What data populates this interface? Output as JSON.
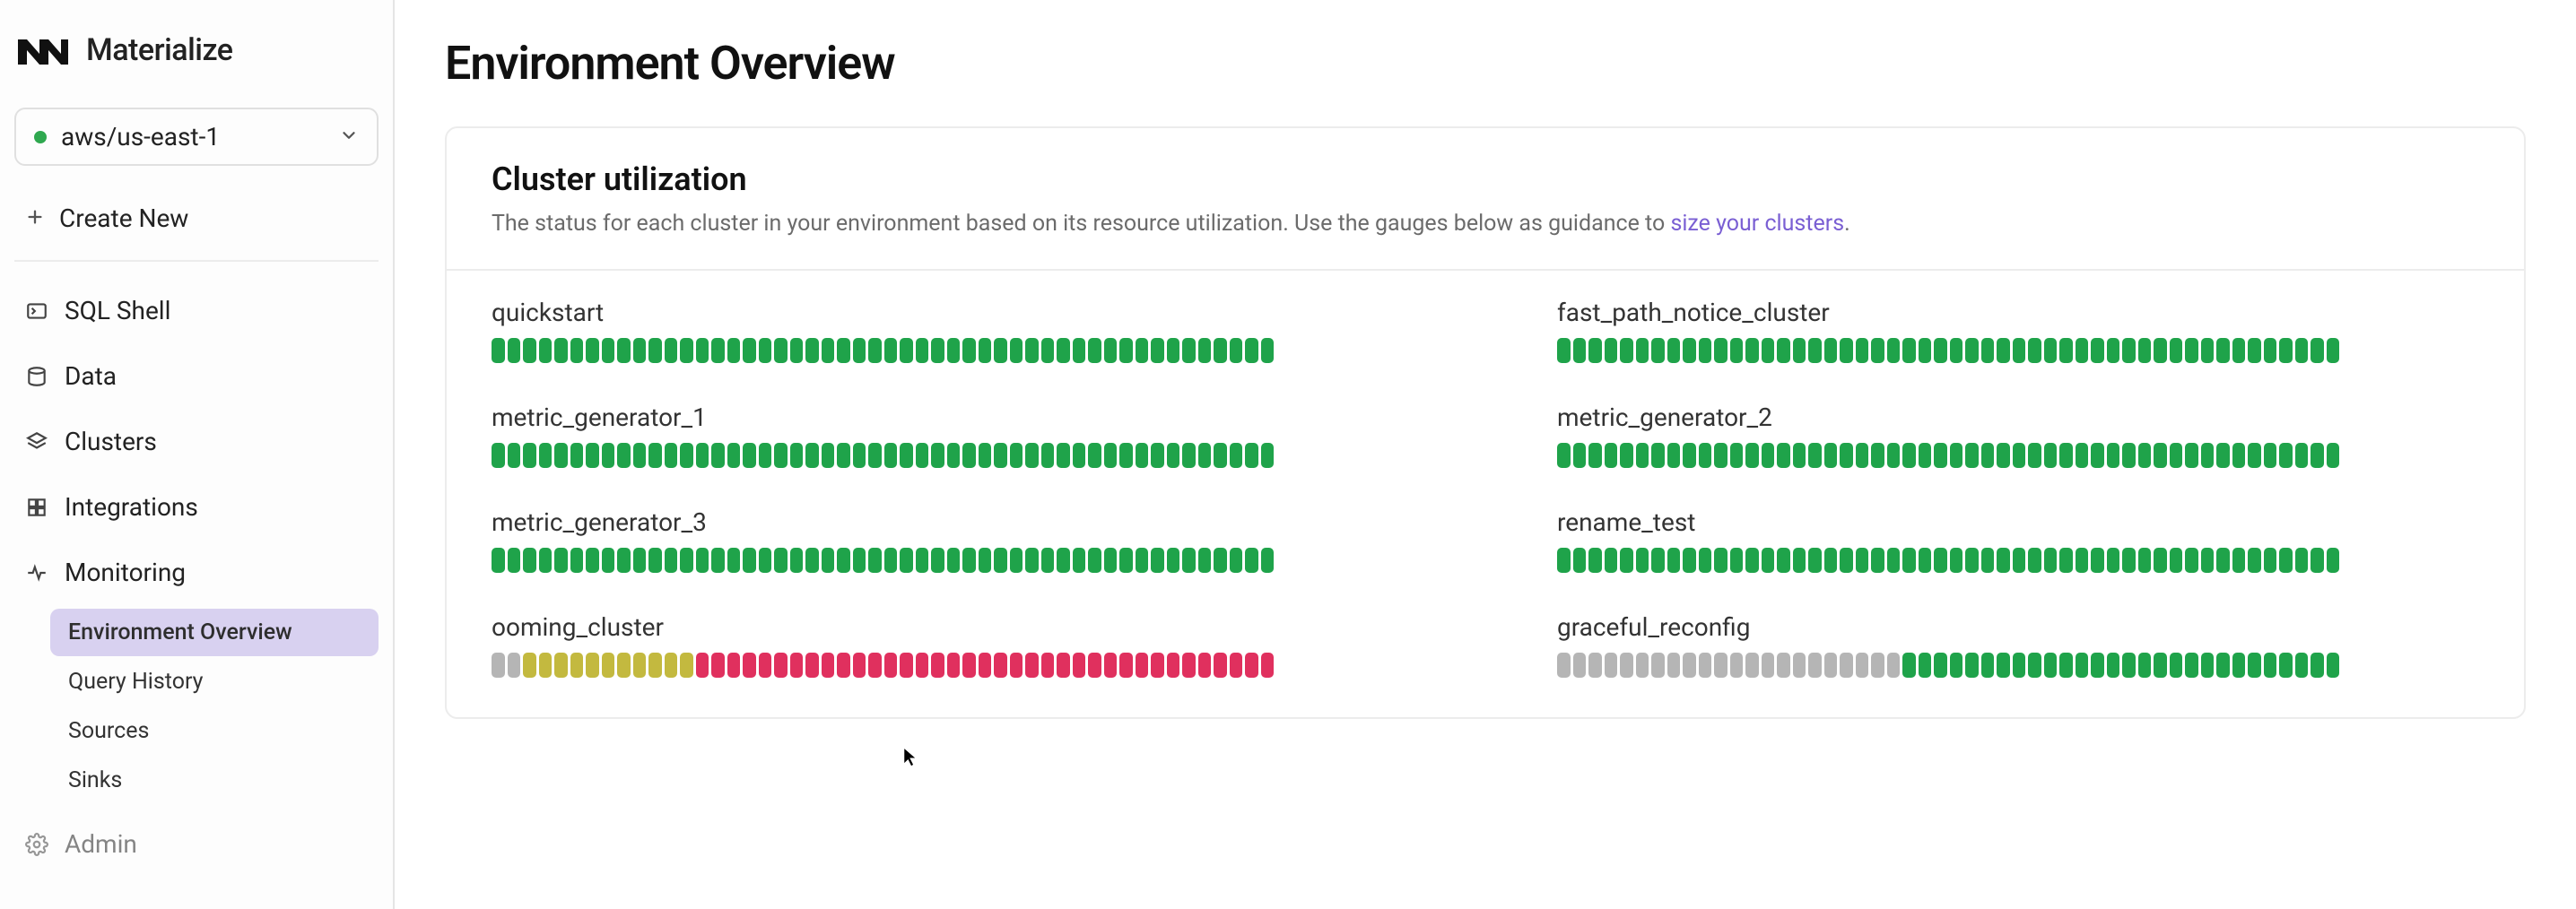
{
  "brand": "Materialize",
  "region": {
    "name": "aws/us-east-1",
    "status": "ok"
  },
  "create_new": "Create New",
  "nav": {
    "sql_shell": "SQL Shell",
    "data": "Data",
    "clusters": "Clusters",
    "integrations": "Integrations",
    "monitoring": "Monitoring",
    "admin": "Admin"
  },
  "subnav": {
    "env_overview": "Environment Overview",
    "query_history": "Query History",
    "sources": "Sources",
    "sinks": "Sinks"
  },
  "page": {
    "title": "Environment Overview"
  },
  "utilization": {
    "title": "Cluster utilization",
    "desc_pre": "The status for each cluster in your environment based on its resource utilization. Use the gauges below as guidance to ",
    "desc_link": "size your clusters",
    "desc_post": ".",
    "segments_per_gauge": 50,
    "clusters": [
      {
        "name": "quickstart",
        "segments": "gggggggggggggggggggggggggggggggggggggggggggggggggg"
      },
      {
        "name": "fast_path_notice_cluster",
        "segments": "gggggggggggggggggggggggggggggggggggggggggggggggggg"
      },
      {
        "name": "metric_generator_1",
        "segments": "gggggggggggggggggggggggggggggggggggggggggggggggggg"
      },
      {
        "name": "metric_generator_2",
        "segments": "gggggggggggggggggggggggggggggggggggggggggggggggggg"
      },
      {
        "name": "metric_generator_3",
        "segments": "gggggggggggggggggggggggggggggggggggggggggggggggggg"
      },
      {
        "name": "rename_test",
        "segments": "gggggggggggggggggggggggggggggggggggggggggggggggggg"
      },
      {
        "name": "ooming_cluster",
        "segments": "xxyyyyyyyyyyyrrrrrrrrrrrrrrrrrrrrrrrrrrrrrrrrrrrrr"
      },
      {
        "name": "graceful_reconfig",
        "segments": "xxxxxxxxxxxxxxxxxxxxxxgggggggggggggggggggggggggggg"
      }
    ]
  },
  "colors": {
    "green": "#1fa34a",
    "yellow": "#c3b93f",
    "red": "#e0305e",
    "gray": "#b5b5b5",
    "accent": "#7a5fd3"
  }
}
